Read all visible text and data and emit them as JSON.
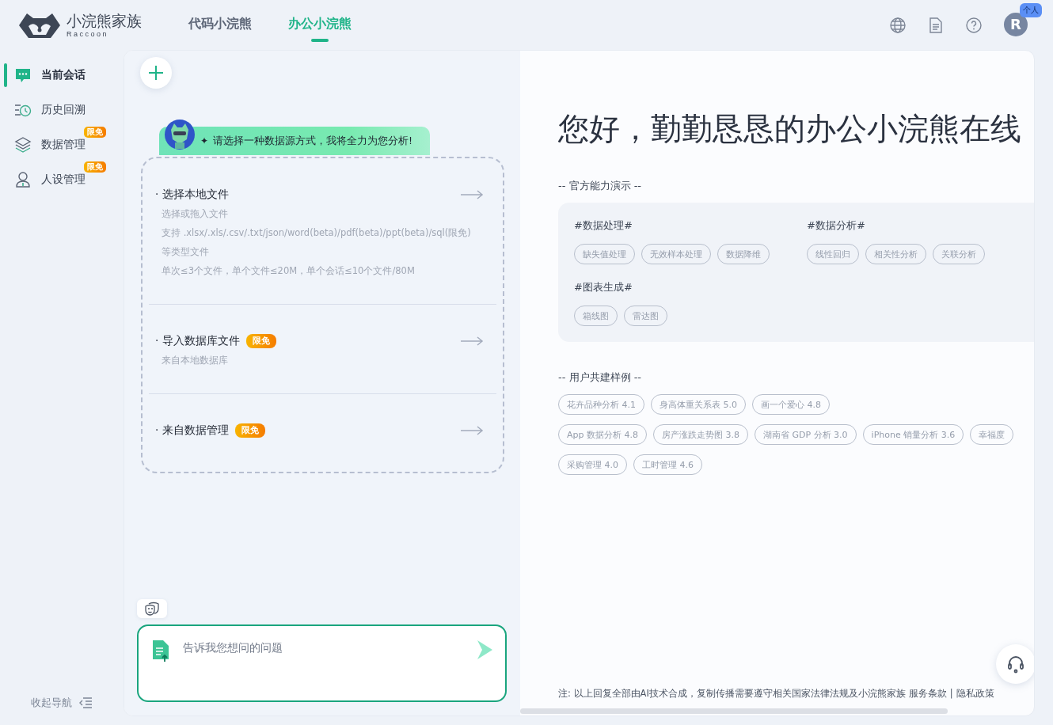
{
  "logo": {
    "name": "小浣熊家族",
    "subtitle": "R a c c o o n"
  },
  "tabs": [
    {
      "label": "代码小浣熊",
      "selected": false
    },
    {
      "label": "办公小浣熊",
      "selected": true
    }
  ],
  "user": {
    "initial": "R",
    "badge": "个人"
  },
  "sidebar": {
    "items": [
      {
        "label": "当前会话",
        "kind": "chat",
        "selected": true
      },
      {
        "label": "历史回溯",
        "kind": "history",
        "selected": false
      },
      {
        "label": "数据管理",
        "kind": "layers",
        "selected": false,
        "badge": "限免"
      },
      {
        "label": "人设管理",
        "kind": "person",
        "selected": false,
        "badge": "限免"
      }
    ],
    "collapse": "收起导航"
  },
  "banner": "请选择一种数据源方式，我将全力为您分析!",
  "banner_mark": "✦",
  "sources": [
    {
      "title": "· 选择本地文件",
      "lines": [
        "选择或拖入文件",
        "支持 .xlsx/.xls/.csv/.txt/json/word(beta)/pdf(beta)/ppt(beta)/sql(限免) 等类型文件",
        "单次≤3个文件，单个文件≤20M，单个会话≤10个文件/80M"
      ]
    },
    {
      "title": "· 导入数据库文件",
      "badge": "限免",
      "lines": [
        "来自本地数据库"
      ]
    },
    {
      "title": "· 来自数据管理",
      "badge": "限免"
    }
  ],
  "input": {
    "placeholder": "告诉我您想问的问题"
  },
  "greeting": "您好，勤勤恳恳的办公小浣熊在线",
  "official": {
    "title": "-- 官方能力演示 --",
    "groups": [
      {
        "title": "#数据处理#",
        "chips": [
          "缺失值处理",
          "无效样本处理",
          "数据降维"
        ]
      },
      {
        "title": "#数据分析#",
        "chips": [
          "线性回归",
          "相关性分析",
          "关联分析"
        ]
      },
      {
        "title": "#图表生成#",
        "chips": [
          "箱线图",
          "雷达图"
        ]
      }
    ]
  },
  "community": {
    "title": "-- 用户共建样例 --",
    "rows": [
      [
        "花卉品种分析 4.1",
        "身高体重关系表 5.0",
        "画一个爱心 4.8"
      ],
      [
        "App 数据分析 4.8",
        "房产涨跌走势图 3.8",
        "湖南省 GDP 分析 3.0",
        "iPhone 销量分析 3.6",
        "幸福度"
      ],
      [
        "采购管理 4.0",
        "工时管理 4.6"
      ]
    ]
  },
  "footer": {
    "note": "注: 以上回复全部由AI技术合成，复制传播需要遵守相关国家法律法规及小浣熊家族",
    "links": [
      "服务条款",
      "隐私政策"
    ],
    "separator": "|"
  }
}
